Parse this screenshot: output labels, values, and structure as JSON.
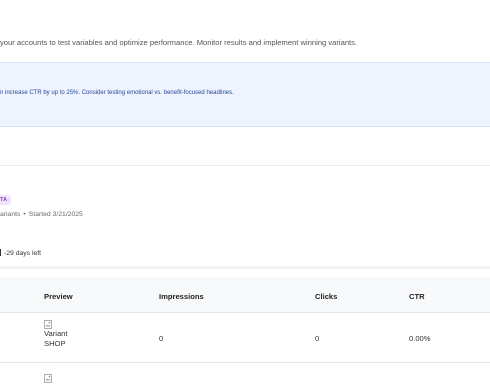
{
  "intro_text": "your accounts to test variables and optimize performance. Monitor results and implement winning variants.",
  "tip_text": "n increase CTR by up to 25%. Consider testing emotional vs. benefit-focused headlines.",
  "test": {
    "badge": "TA",
    "variants_fragment": "ariants",
    "started": "Started 3/21/2025",
    "days_left": "-29 days left"
  },
  "table": {
    "headers": [
      "Preview",
      "Impressions",
      "Clicks",
      "CTR"
    ],
    "rows": [
      {
        "preview_alt": "Variant SHOP",
        "preview_line1": "Variant",
        "preview_line2": "SHOP",
        "impressions": "0",
        "clicks": "0",
        "ctr": "0.00%"
      }
    ]
  },
  "icons": [
    "broken-image-icon"
  ]
}
